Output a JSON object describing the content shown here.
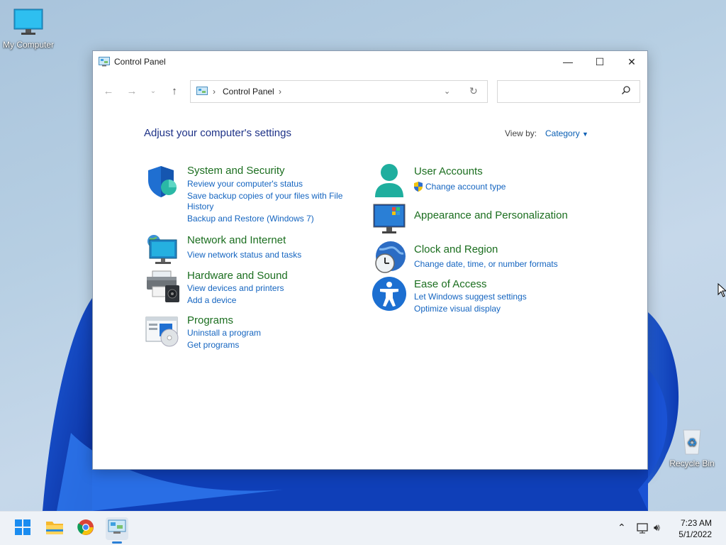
{
  "desktop": {
    "icons": [
      {
        "label": "My Computer",
        "icon": "monitor-icon"
      },
      {
        "label": "Recycle Bin",
        "icon": "recycle-bin-icon"
      }
    ]
  },
  "window": {
    "title": "Control Panel",
    "controls": {
      "minimize": "—",
      "maximize": "☐",
      "close": "✕"
    },
    "address": {
      "crumb": "Control Panel",
      "separator": "›"
    },
    "search": {
      "placeholder": ""
    },
    "heading": "Adjust your computer's settings",
    "view_by_label": "View by:",
    "view_by_value": "Category",
    "categories": [
      {
        "title": "System and Security",
        "icon": "shield-icon",
        "links": [
          "Review your computer's status",
          "Save backup copies of your files with File",
          "History",
          "Backup and Restore (Windows 7)"
        ]
      },
      {
        "title": "Network and Internet",
        "icon": "network-globe-icon",
        "links": [
          "View network status and tasks"
        ]
      },
      {
        "title": "Hardware and Sound",
        "icon": "printer-icon",
        "links": [
          "View devices and printers",
          "Add a device"
        ]
      },
      {
        "title": "Programs",
        "icon": "programs-icon",
        "links": [
          "Uninstall a program",
          "Get programs"
        ]
      },
      {
        "title": "User Accounts",
        "icon": "user-icon",
        "links": [
          "Change account type"
        ]
      },
      {
        "title": "Appearance and Personalization",
        "icon": "display-icon",
        "links": []
      },
      {
        "title": "Clock and Region",
        "icon": "clock-globe-icon",
        "links": [
          "Change date, time, or number formats"
        ]
      },
      {
        "title": "Ease of Access",
        "icon": "accessibility-icon",
        "links": [
          "Let Windows suggest settings",
          "Optimize visual display"
        ]
      }
    ]
  },
  "taskbar": {
    "items": [
      "start-icon",
      "file-explorer-icon",
      "chrome-icon",
      "control-panel-icon"
    ],
    "time": "7:23 AM",
    "date": "5/1/2022"
  },
  "colors": {
    "category_title": "#1b6e1f",
    "link": "#1565c0",
    "heading": "#1e3287"
  }
}
